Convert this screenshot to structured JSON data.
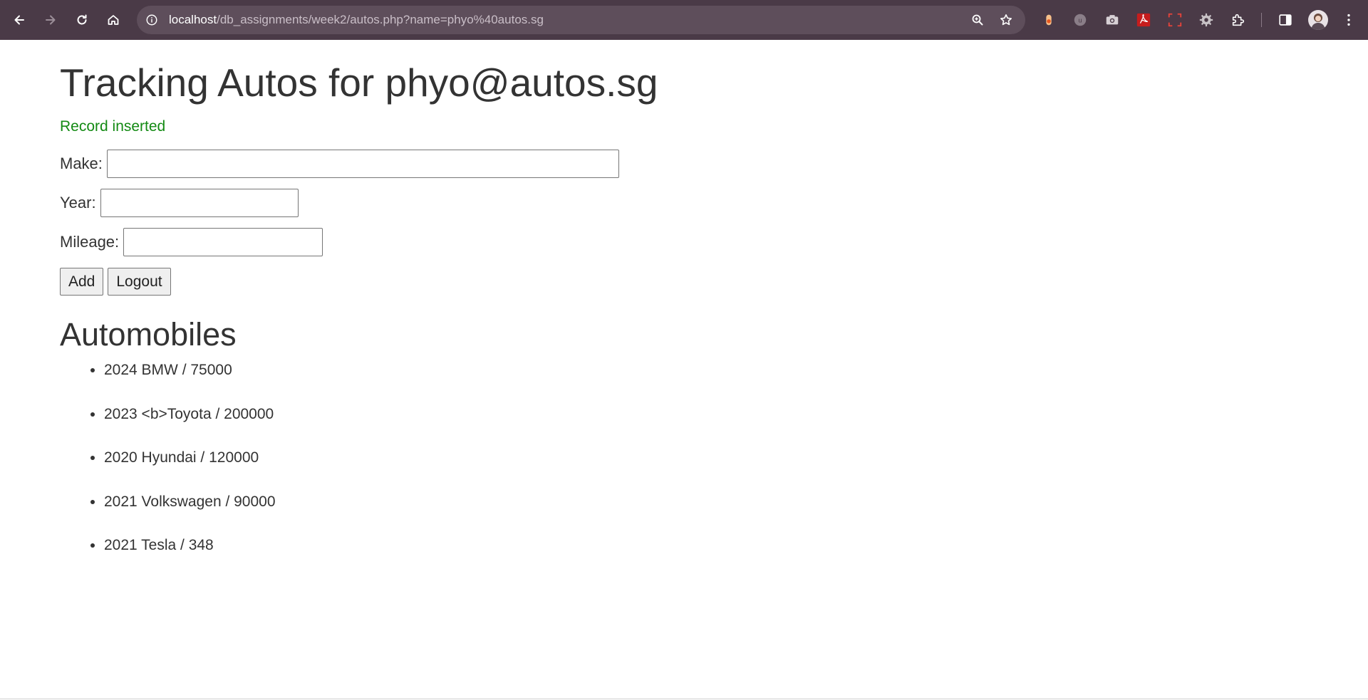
{
  "browser": {
    "url_host": "localhost",
    "url_path": "/db_assignments/week2/autos.php?name=phyo%40autos.sg"
  },
  "page": {
    "title": "Tracking Autos for phyo@autos.sg",
    "flash_message": "Record inserted",
    "flash_color": "#138a13",
    "form": {
      "make_label": "Make:",
      "make_value": "",
      "year_label": "Year:",
      "year_value": "",
      "mileage_label": "Mileage:",
      "mileage_value": "",
      "add_label": "Add",
      "logout_label": "Logout"
    },
    "section_title": "Automobiles",
    "autos": [
      "2024 BMW / 75000",
      "2023 <b>Toyota / 200000",
      "2020 Hyundai / 120000",
      "2021 Volkswagen / 90000",
      "2021 Tesla / 348"
    ]
  }
}
